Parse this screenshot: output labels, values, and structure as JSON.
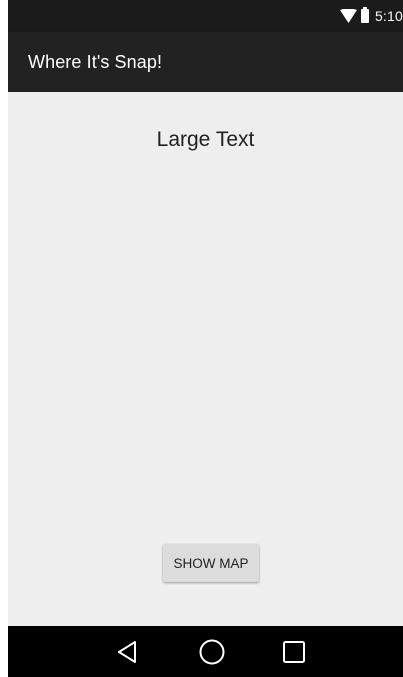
{
  "status_bar": {
    "time": "5:10",
    "wifi_icon": "wifi-icon",
    "battery_icon": "battery-icon"
  },
  "app_bar": {
    "title": "Where It's Snap!"
  },
  "main": {
    "large_text": "Large Text",
    "show_map_label": "SHOW MAP"
  },
  "nav_bar": {
    "back_icon": "back-triangle-icon",
    "home_icon": "home-circle-icon",
    "recents_icon": "recents-square-icon"
  },
  "colors": {
    "app_bar": "#222222",
    "status_bar": "#1b1b1b",
    "background": "#eeeeee",
    "button": "#dcdcdc",
    "nav_bar": "#000000"
  }
}
